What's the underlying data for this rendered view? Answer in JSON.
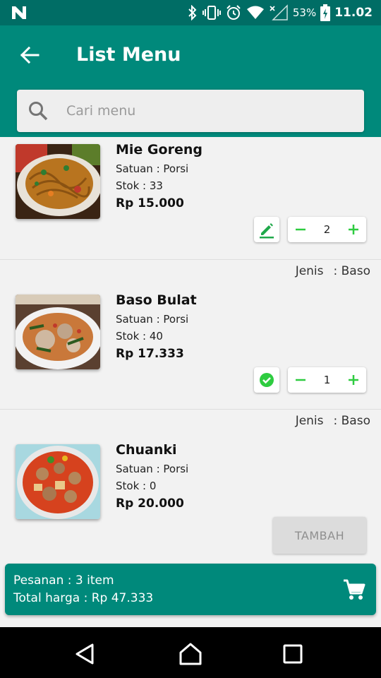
{
  "status_bar": {
    "battery": "53%",
    "time": "11.02",
    "icons": [
      "notification-n-icon",
      "bluetooth-icon",
      "vibrate-icon",
      "alarm-icon",
      "wifi-icon",
      "no-signal-icon",
      "battery-charging-icon"
    ]
  },
  "header": {
    "title": "List Menu",
    "back_icon": "arrow-back-icon"
  },
  "search": {
    "placeholder": "Cari menu",
    "value": "",
    "icon": "search-icon"
  },
  "menu_items": [
    {
      "jenis_label": "Jenis",
      "jenis_value": ": Baso",
      "name": "Mie Goreng",
      "unit": "Satuan : Porsi",
      "stock": "Stok : 33",
      "price": "Rp 15.000",
      "action_icon": "edit-pencil-icon",
      "quantity": "2",
      "jenis_visible": false
    },
    {
      "jenis_label": "Jenis",
      "jenis_value": ": Baso",
      "name": "Baso Bulat",
      "unit": "Satuan : Porsi",
      "stock": "Stok : 40",
      "price": "Rp 17.333",
      "action_icon": "check-circle-icon",
      "quantity": "1",
      "jenis_visible": true
    },
    {
      "jenis_label": "Jenis",
      "jenis_value": ": Baso",
      "name": "Chuanki",
      "unit": "Satuan : Porsi",
      "stock": "Stok : 0",
      "price": "Rp 20.000",
      "add_label": "TAMBAH",
      "jenis_visible": true
    }
  ],
  "order": {
    "count": "Pesanan : 3 item",
    "total": "Total harga : Rp 47.333",
    "cart_icon": "cart-icon"
  },
  "nav": {
    "icons": [
      "nav-back-icon",
      "nav-home-icon",
      "nav-recents-icon"
    ]
  },
  "colors": {
    "primary": "#00897b",
    "primary_dark": "#006d65",
    "accent_green": "#2ecc40",
    "edit_green": "#1fa84a"
  }
}
